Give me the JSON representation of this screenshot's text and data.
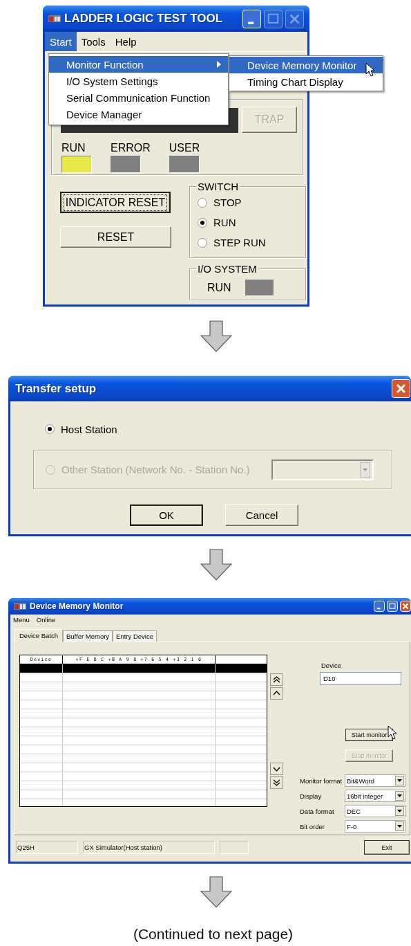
{
  "ladder_tool": {
    "title": "LADDER LOGIC TEST TOOL",
    "menu": [
      {
        "label": "Start",
        "selected": true
      },
      {
        "label": "Tools",
        "selected": false
      },
      {
        "label": "Help",
        "selected": false
      }
    ],
    "dropdown": [
      {
        "label": "Monitor Function",
        "selected": true,
        "has_submenu": true
      },
      {
        "label": "I/O System Settings",
        "selected": false,
        "has_submenu": false
      },
      {
        "label": "Serial Communication Function",
        "selected": false,
        "has_submenu": false
      },
      {
        "label": "Device Manager",
        "selected": false,
        "has_submenu": false
      }
    ],
    "submenu": [
      {
        "label": "Device Memory Monitor",
        "selected": true
      },
      {
        "label": "Timing Chart Display",
        "selected": false
      }
    ],
    "trap_button": {
      "label": "TRAP",
      "disabled": true
    },
    "indicators": [
      {
        "label": "RUN",
        "color": "#e8e84a"
      },
      {
        "label": "ERROR",
        "color": "#808080"
      },
      {
        "label": "USER",
        "color": "#808080"
      }
    ],
    "indicator_reset": {
      "label": "INDICATOR RESET",
      "focused": true
    },
    "reset": {
      "label": "RESET"
    },
    "switch": {
      "title": "SWITCH",
      "options": [
        {
          "label": "STOP",
          "selected": false
        },
        {
          "label": "RUN",
          "selected": true
        },
        {
          "label": "STEP RUN",
          "selected": false
        }
      ]
    },
    "io_system": {
      "title": "I/O SYSTEM",
      "label": "RUN",
      "color": "#808080"
    }
  },
  "transfer_setup": {
    "title": "Transfer setup",
    "host_option": {
      "label": "Host Station",
      "selected": true,
      "disabled": false
    },
    "other_option": {
      "label": "Other Station (Network No. - Station No.)",
      "selected": false,
      "disabled": true
    },
    "station_combo": {
      "disabled": true
    },
    "buttons": [
      {
        "label": "OK",
        "default": true
      },
      {
        "label": "Cancel",
        "default": false
      }
    ]
  },
  "device_memory_monitor": {
    "title": "Device Memory Monitor",
    "menu": [
      "Menu",
      "Online"
    ],
    "tabs": [
      {
        "label": "Device Batch",
        "selected": true
      },
      {
        "label": "Buffer Memory",
        "selected": false
      },
      {
        "label": "Entry Device",
        "selected": false
      }
    ],
    "table": {
      "columns": [
        "Device",
        "+F E D C +B A 9 8 +7 6 5 4 +3 2 1 0"
      ],
      "rows": [
        {
          "selected": true
        },
        {
          "selected": false
        },
        {
          "selected": false
        },
        {
          "selected": false
        },
        {
          "selected": false
        },
        {
          "selected": false
        },
        {
          "selected": false
        },
        {
          "selected": false
        },
        {
          "selected": false
        },
        {
          "selected": false
        },
        {
          "selected": false
        },
        {
          "selected": false
        },
        {
          "selected": false
        },
        {
          "selected": false
        },
        {
          "selected": false
        },
        {
          "selected": false
        }
      ]
    },
    "device_field": {
      "label": "Device",
      "value": "D10"
    },
    "monitor_buttons": [
      {
        "label": "Start monitor",
        "disabled": false
      },
      {
        "label": "Stop monitor",
        "disabled": true
      }
    ],
    "settings": [
      {
        "label": "Monitor format",
        "value": "Bit&Word"
      },
      {
        "label": "Display",
        "value": "16bit integer"
      },
      {
        "label": "Data format",
        "value": "DEC"
      },
      {
        "label": "Bit order",
        "value": "F-0"
      }
    ],
    "status_bar": [
      "Q25H",
      "GX Simulator(Host station)"
    ],
    "exit_button": {
      "label": "Exit"
    }
  },
  "caption": "(Continued to next page)"
}
